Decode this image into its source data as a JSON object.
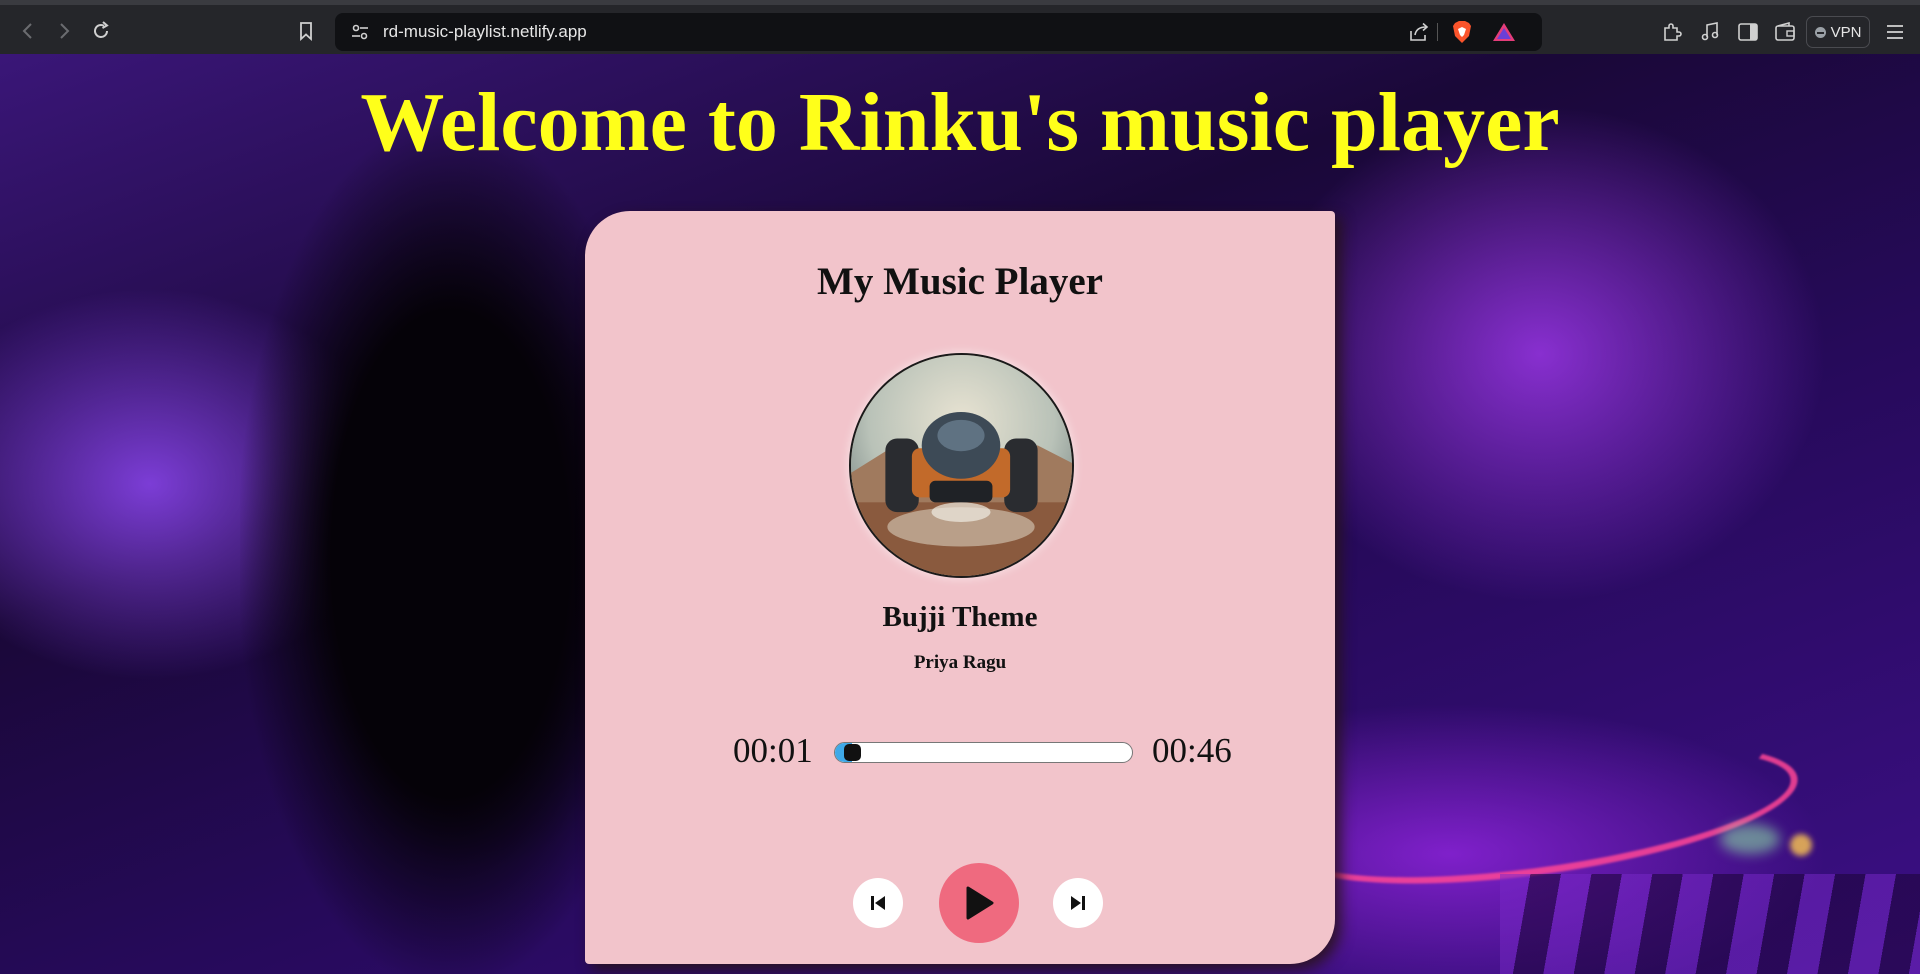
{
  "browser": {
    "url": "rd-music-playlist.netlify.app",
    "vpn_label": "VPN",
    "icons": [
      "back-icon",
      "forward-icon",
      "reload-icon",
      "bookmark-icon",
      "site-settings-icon",
      "share-icon",
      "brave-shield-icon",
      "brave-rewards-icon",
      "extensions-icon",
      "media-icon",
      "sidebar-icon",
      "wallet-icon"
    ]
  },
  "page": {
    "heading": "Welcome to Rinku's music player",
    "heading_color": "#ffff1a"
  },
  "player": {
    "title": "My Music Player",
    "song_title": "Bujji Theme",
    "artist": "Priya Ragu",
    "current_time": "00:01",
    "total_time": "00:46",
    "progress_fraction": 0.03,
    "card_color": "#f2c4cb",
    "play_button_color": "#ef6a7f",
    "controls": [
      "previous-icon",
      "play-icon",
      "next-icon"
    ]
  }
}
